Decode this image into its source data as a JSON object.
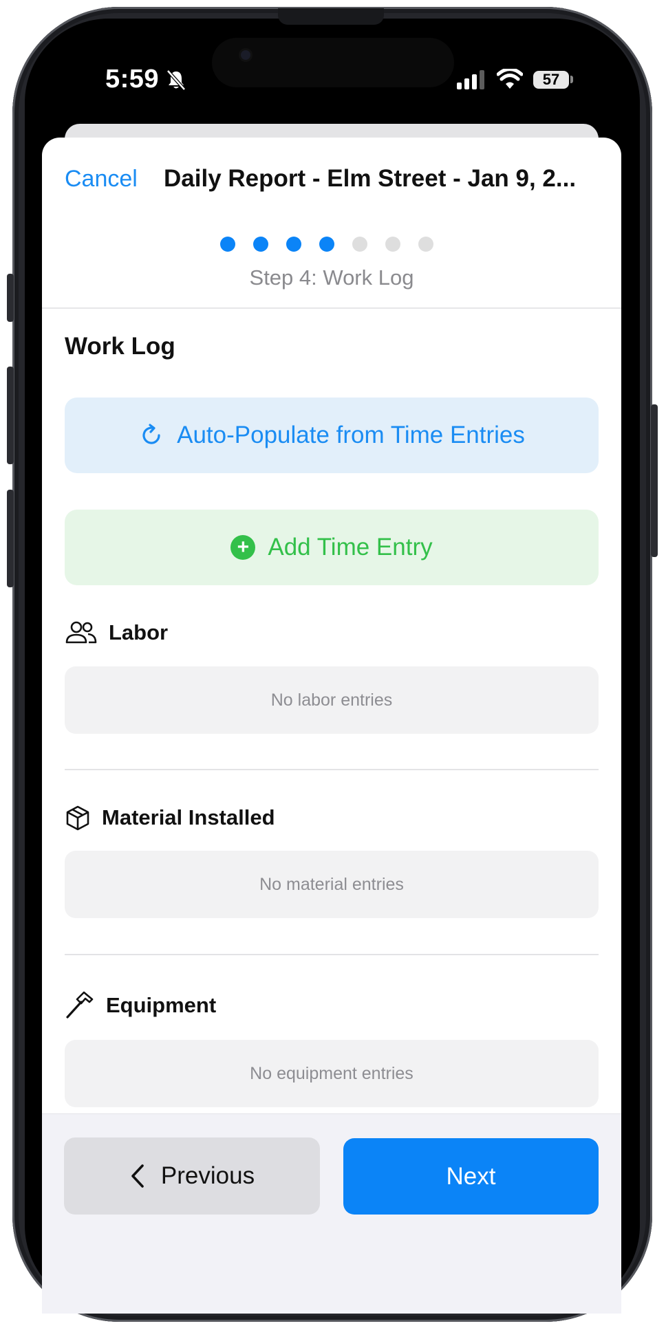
{
  "status_bar": {
    "time": "5:59",
    "battery": "57",
    "icons": [
      "bell-slash-icon",
      "cellular-signal-icon",
      "wifi-icon",
      "battery-icon"
    ]
  },
  "header": {
    "cancel_label": "Cancel",
    "title": "Daily Report - Elm Street - Jan 9, 2...",
    "step_label": "Step 4: Work Log",
    "steps_total": 7,
    "steps_completed": 4
  },
  "content": {
    "section_title": "Work Log",
    "auto_populate_label": "Auto-Populate from Time Entries",
    "add_time_entry_label": "Add Time Entry",
    "groups": {
      "labor": {
        "title": "Labor",
        "empty_text": "No labor entries",
        "icon": "people-icon"
      },
      "material": {
        "title": "Material Installed",
        "empty_text": "No material entries",
        "icon": "box-icon"
      },
      "equipment": {
        "title": "Equipment",
        "empty_text": "No equipment entries",
        "icon": "hammer-icon"
      }
    }
  },
  "footer": {
    "previous_label": "Previous",
    "next_label": "Next"
  },
  "colors": {
    "accent_blue": "#0b84f7",
    "link_blue": "#1a8cf3",
    "success_green": "#33c04a",
    "muted_text": "#8d8d92"
  }
}
